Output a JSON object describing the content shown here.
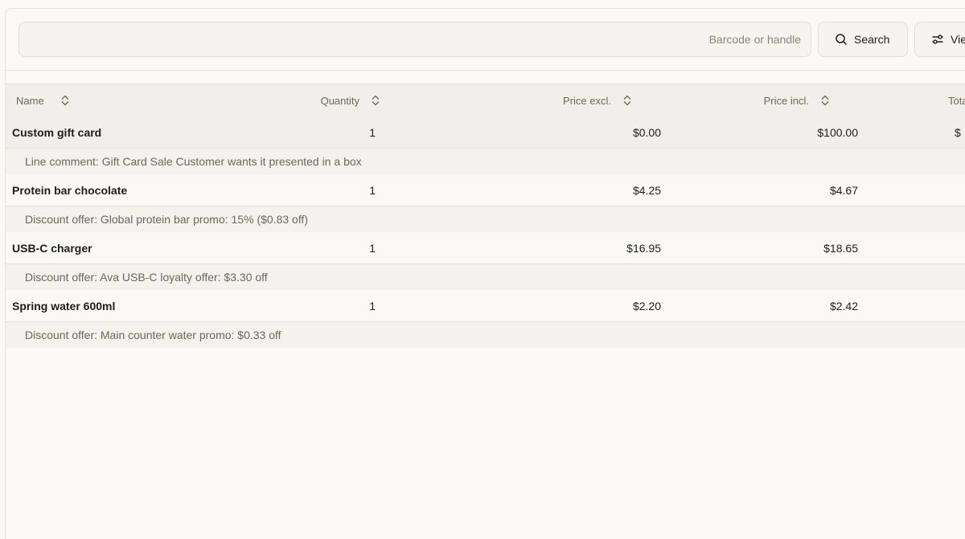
{
  "toolbar": {
    "search_placeholder": "Barcode or handle",
    "search_value": "",
    "search_button_label": "Search",
    "view_button_label": "Vie"
  },
  "table": {
    "columns": {
      "name": "Name",
      "quantity": "Quantity",
      "price_excl": "Price excl.",
      "price_incl": "Price incl.",
      "total": "Tota"
    },
    "rows": [
      {
        "name": "Custom gift card",
        "quantity": "1",
        "price_excl": "$0.00",
        "price_incl": "$100.00",
        "total": "$",
        "note": "Line comment: Gift Card Sale Customer wants it presented in a box"
      },
      {
        "name": "Protein bar chocolate",
        "quantity": "1",
        "price_excl": "$4.25",
        "price_incl": "$4.67",
        "total": "",
        "note": "Discount offer: Global protein bar promo: 15% ($0.83 off)"
      },
      {
        "name": "USB-C charger",
        "quantity": "1",
        "price_excl": "$16.95",
        "price_incl": "$18.65",
        "total": "",
        "note": "Discount offer: Ava USB-C loyalty offer: $3.30 off"
      },
      {
        "name": "Spring water 600ml",
        "quantity": "1",
        "price_excl": "$2.20",
        "price_incl": "$2.42",
        "total": "",
        "note": "Discount offer: Main counter water promo: $0.33 off"
      }
    ]
  },
  "icons": {
    "search": "search-icon",
    "view": "sliders-icon",
    "sort": "sort-icon"
  }
}
